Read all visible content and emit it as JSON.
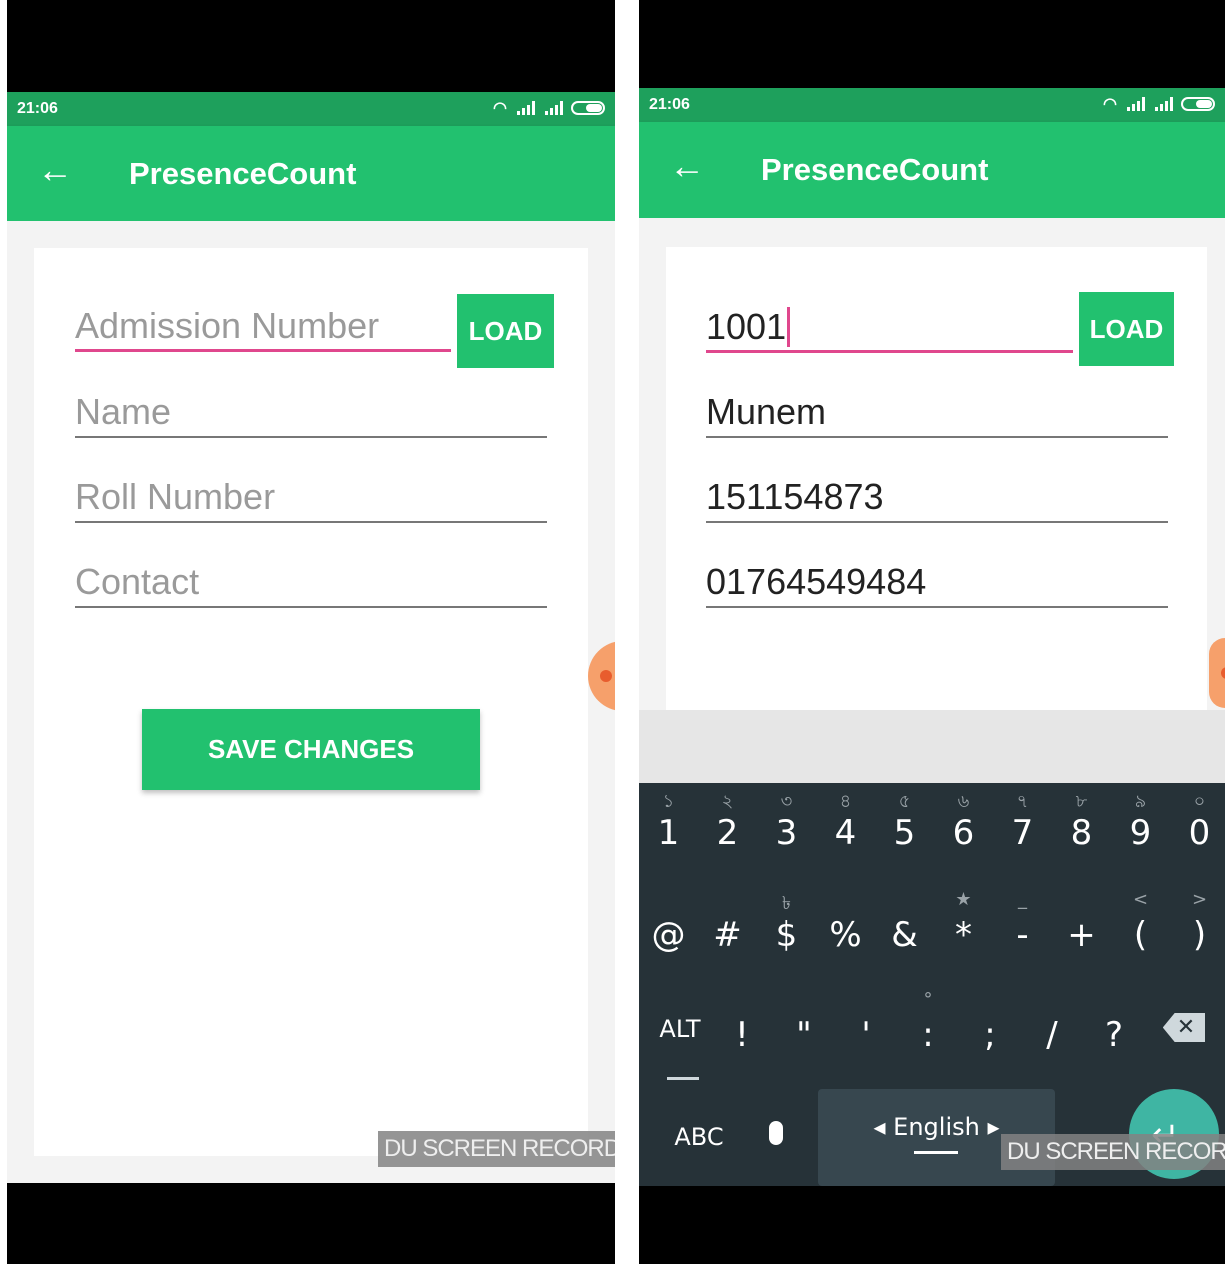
{
  "status_time": "21:06",
  "app_title": "PresenceCount",
  "load_label": "LOAD",
  "save_label": "SAVE CHANGES",
  "watermark": "DU SCREEN RECORDER",
  "left_form": {
    "admission_placeholder": "Admission Number",
    "name_placeholder": "Name",
    "roll_placeholder": "Roll Number",
    "contact_placeholder": "Contact"
  },
  "right_form": {
    "admission_value": "1001",
    "name_value": "Munem",
    "roll_value": "151154873",
    "contact_value": "01764549484"
  },
  "keyboard": {
    "row1": [
      {
        "main": "1",
        "hint": "১"
      },
      {
        "main": "2",
        "hint": "২"
      },
      {
        "main": "3",
        "hint": "৩"
      },
      {
        "main": "4",
        "hint": "৪"
      },
      {
        "main": "5",
        "hint": "৫"
      },
      {
        "main": "6",
        "hint": "৬"
      },
      {
        "main": "7",
        "hint": "৭"
      },
      {
        "main": "8",
        "hint": "৮"
      },
      {
        "main": "9",
        "hint": "৯"
      },
      {
        "main": "0",
        "hint": "০"
      }
    ],
    "row2": [
      {
        "main": "@",
        "hint": ""
      },
      {
        "main": "#",
        "hint": ""
      },
      {
        "main": "$",
        "hint": "৳"
      },
      {
        "main": "%",
        "hint": ""
      },
      {
        "main": "&",
        "hint": ""
      },
      {
        "main": "*",
        "hint": "★"
      },
      {
        "main": "-",
        "hint": "_"
      },
      {
        "main": "+",
        "hint": ""
      },
      {
        "main": "(",
        "hint": "<"
      },
      {
        "main": ")",
        "hint": ">"
      }
    ],
    "row3": [
      {
        "main": "ALT",
        "hint": ""
      },
      {
        "main": "!",
        "hint": ""
      },
      {
        "main": "\"",
        "hint": ""
      },
      {
        "main": "'",
        "hint": ""
      },
      {
        "main": ":",
        "hint": "°"
      },
      {
        "main": ";",
        "hint": ""
      },
      {
        "main": "/",
        "hint": ""
      },
      {
        "main": "?",
        "hint": ""
      }
    ],
    "abc_label": "ABC",
    "language_label": "◂ English ▸",
    "backspace_icon": "backspace-icon",
    "mic_icon": "microphone-icon",
    "enter_icon": "enter-icon"
  },
  "colors": {
    "status_bar": "#1ea05c",
    "app_bar": "#22c16f",
    "accent_pink": "#e0478d",
    "keyboard_bg": "#263238"
  }
}
